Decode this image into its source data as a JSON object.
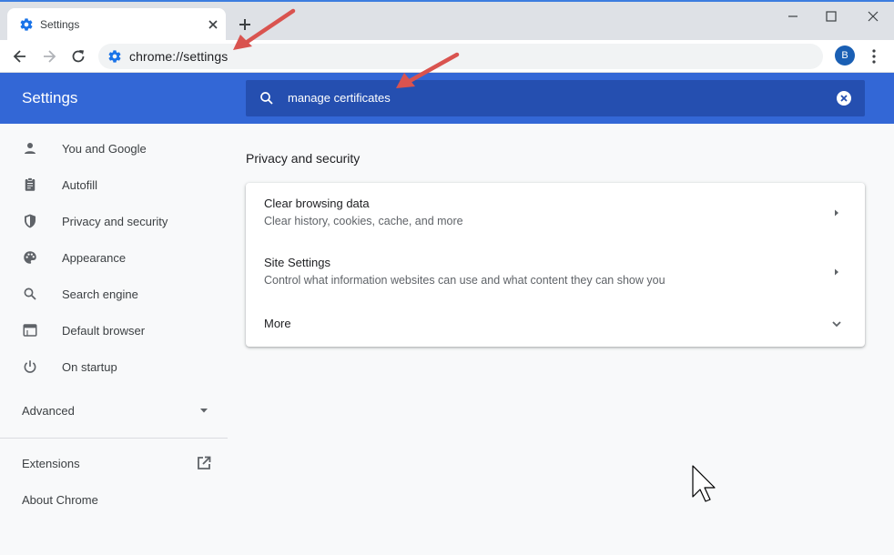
{
  "browser": {
    "tab": {
      "title": "Settings"
    },
    "url": "chrome://settings",
    "profile_initial": "B"
  },
  "header": {
    "title": "Settings",
    "search_value": "manage certificates"
  },
  "sidebar": {
    "items": [
      {
        "label": "You and Google",
        "icon": "person-icon"
      },
      {
        "label": "Autofill",
        "icon": "clipboard-icon"
      },
      {
        "label": "Privacy and security",
        "icon": "shield-icon"
      },
      {
        "label": "Appearance",
        "icon": "palette-icon"
      },
      {
        "label": "Search engine",
        "icon": "search-icon"
      },
      {
        "label": "Default browser",
        "icon": "browser-window-icon"
      },
      {
        "label": "On startup",
        "icon": "power-icon"
      }
    ],
    "advanced": "Advanced",
    "extensions": "Extensions",
    "about": "About Chrome"
  },
  "main": {
    "section_title": "Privacy and security",
    "rows": [
      {
        "title": "Clear browsing data",
        "subtitle": "Clear history, cookies, cache, and more"
      },
      {
        "title": "Site Settings",
        "subtitle": "Control what information websites can use and what content they can show you"
      }
    ],
    "more_label": "More"
  },
  "colors": {
    "header_blue": "#3367d6",
    "search_blue": "#254fb0",
    "annotation_arrow": "#d9534f"
  }
}
